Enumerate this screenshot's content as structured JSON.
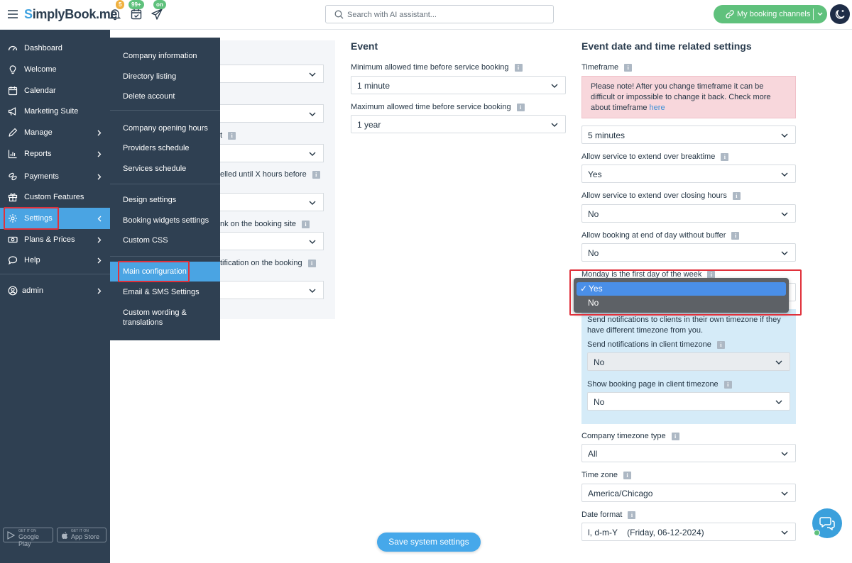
{
  "app": {
    "logo_initial": "S",
    "logo_rest": "implyBook.me"
  },
  "topbar": {
    "badges": {
      "notifications": "5",
      "bookings": "99+",
      "channels": "on"
    },
    "search_placeholder": "Search with AI assistant...",
    "channels_button": "My booking channels"
  },
  "sidebar": {
    "items": [
      {
        "label": "Dashboard",
        "icon": "speedometer-icon"
      },
      {
        "label": "Welcome",
        "icon": "lightbulb-icon"
      },
      {
        "label": "Calendar",
        "icon": "calendar-icon"
      },
      {
        "label": "Marketing Suite",
        "icon": "megaphone-icon"
      },
      {
        "label": "Manage",
        "icon": "pencil-icon"
      },
      {
        "label": "Reports",
        "icon": "bar-chart-icon"
      },
      {
        "label": "Payments",
        "icon": "coins-icon"
      },
      {
        "label": "Custom Features",
        "icon": "gift-icon"
      },
      {
        "label": "Settings",
        "icon": "gear-icon"
      },
      {
        "label": "Plans & Prices",
        "icon": "banknote-icon"
      },
      {
        "label": "Help",
        "icon": "chat-bubble-icon"
      },
      {
        "label": "admin",
        "icon": "user-icon"
      }
    ],
    "stores": {
      "google_small": "GET IT ON",
      "google": "Google Play",
      "apple_small": "GET IT ON",
      "apple": "App Store"
    }
  },
  "submenu": {
    "groups": [
      [
        "Company information",
        "Directory listing",
        "Delete account"
      ],
      [
        "Company opening hours",
        "Providers schedule",
        "Services schedule"
      ],
      [
        "Design settings",
        "Booking widgets settings",
        "Custom CSS"
      ],
      [
        "Main configuration",
        "Email & SMS Settings",
        "Custom wording & translations"
      ]
    ]
  },
  "left_partial": {
    "label1": "t",
    "label2": "elled until X hours before",
    "label3": "nk on the booking site",
    "label4": "tification on the booking"
  },
  "event": {
    "heading": "Event",
    "min_label": "Minimum allowed time before service booking",
    "min_value": "1 minute",
    "max_label": "Maximum allowed time before service booking",
    "max_value": "1 year"
  },
  "datetime": {
    "heading": "Event date and time related settings",
    "timeframe_label": "Timeframe",
    "warning_text": "Please note! After you change timeframe it can be difficult or impossible to change it back. Check more about timeframe",
    "warning_link": "here",
    "timeframe_value": "5 minutes",
    "breaktime_label": "Allow service to extend over breaktime",
    "breaktime_value": "Yes",
    "closing_label": "Allow service to extend over closing hours",
    "closing_value": "No",
    "buffer_label": "Allow booking at end of day without buffer",
    "buffer_value": "No",
    "monday_label": "Monday is the first day of the week",
    "monday_options": [
      "Yes",
      "No"
    ],
    "monday_check": "✓",
    "tz_note": "Send notifications to clients in their own timezone if they have different timezone from you.",
    "notif_label": "Send notifications in client timezone",
    "notif_value": "No",
    "showpage_label": "Show booking page in client timezone",
    "showpage_value": "No",
    "tztype_label": "Company timezone type",
    "tztype_value": "All",
    "timezone_label": "Time zone",
    "timezone_value": "America/Chicago",
    "dateformat_label": "Date format",
    "dateformat_value": "l, d-m-Y    (Friday, 06-12-2024)"
  },
  "save_button": "Save system settings",
  "colors": {
    "sidebar": "#2f4052",
    "active": "#4aa4e3",
    "green": "#5fc17c",
    "highlight": "#e0313b"
  }
}
